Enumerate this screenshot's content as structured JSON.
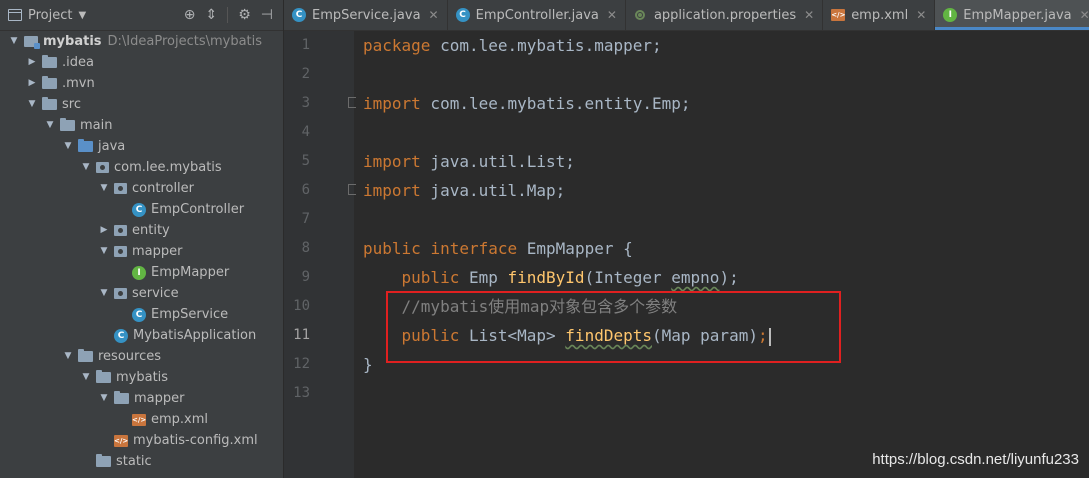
{
  "project_panel": {
    "title": "Project",
    "tree": [
      {
        "label": "mybatis",
        "path": "D:\\IdeaProjects\\mybatis",
        "icon": "module-folder-icon"
      },
      {
        "label": ".idea",
        "icon": "folder-icon"
      },
      {
        "label": ".mvn",
        "icon": "folder-icon"
      },
      {
        "label": "src",
        "icon": "folder-icon"
      },
      {
        "label": "main",
        "icon": "folder-icon"
      },
      {
        "label": "java",
        "icon": "source-folder-icon"
      },
      {
        "label": "com.lee.mybatis",
        "icon": "package-icon"
      },
      {
        "label": "controller",
        "icon": "package-icon"
      },
      {
        "label": "EmpController",
        "icon": "class-icon"
      },
      {
        "label": "entity",
        "icon": "package-icon"
      },
      {
        "label": "mapper",
        "icon": "package-icon"
      },
      {
        "label": "EmpMapper",
        "icon": "interface-icon"
      },
      {
        "label": "service",
        "icon": "package-icon"
      },
      {
        "label": "EmpService",
        "icon": "class-icon"
      },
      {
        "label": "MybatisApplication",
        "icon": "spring-boot-class-icon"
      },
      {
        "label": "resources",
        "icon": "resources-folder-icon"
      },
      {
        "label": "mybatis",
        "icon": "folder-icon"
      },
      {
        "label": "mapper",
        "icon": "folder-icon"
      },
      {
        "label": "emp.xml",
        "icon": "xml-file-icon"
      },
      {
        "label": "mybatis-config.xml",
        "icon": "xml-file-icon"
      },
      {
        "label": "static",
        "icon": "folder-icon"
      }
    ]
  },
  "tabs": [
    {
      "label": "EmpService.java",
      "icon": "class-icon"
    },
    {
      "label": "EmpController.java",
      "icon": "class-icon"
    },
    {
      "label": "application.properties",
      "icon": "properties-file-icon"
    },
    {
      "label": "emp.xml",
      "icon": "xml-file-icon"
    },
    {
      "label": "EmpMapper.java",
      "icon": "interface-icon",
      "active": true
    }
  ],
  "editor": {
    "line_numbers": [
      "1",
      "2",
      "3",
      "4",
      "5",
      "6",
      "7",
      "8",
      "9",
      "10",
      "11",
      "12",
      "13"
    ],
    "current_line": "11",
    "lines": {
      "l1": {
        "kw": "package",
        "rest": " com.lee.mybatis.mapper;"
      },
      "l3": {
        "kw": "import",
        "rest": " com.lee.mybatis.entity.Emp;"
      },
      "l5": {
        "kw": "import",
        "rest": " java.util.List;"
      },
      "l6": {
        "kw": "import",
        "rest": " java.util.Map;"
      },
      "l8": {
        "kw1": "public",
        "kw2": "interface",
        "rest": " EmpMapper {"
      },
      "l9": {
        "kw": "public",
        "type": " Emp ",
        "method": "findById",
        "params_open": "(Integer ",
        "param": "empno",
        "params_close": ");"
      },
      "l10": {
        "comment": "//mybatis使用map对象包含多个参数"
      },
      "l11": {
        "kw": "public",
        "type": " List<Map> ",
        "method": "findDepts",
        "params": "(Map param)",
        "semi": ";"
      },
      "l12": {
        "rest": "}"
      }
    }
  },
  "watermark": "https://blog.csdn.net/liyunfu233",
  "colors": {
    "keyword": "#cc7832",
    "method": "#ffc66d",
    "comment": "#808080",
    "highlight_box": "#e02020",
    "active_tab_indicator": "#4a88c7"
  }
}
